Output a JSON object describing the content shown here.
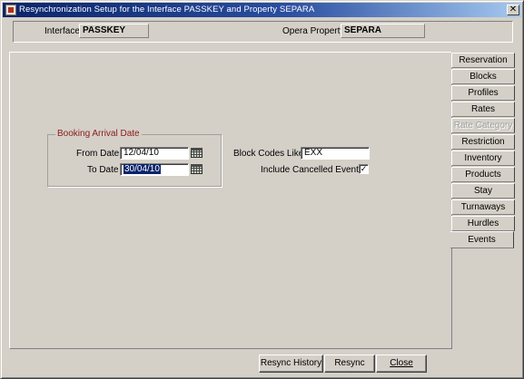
{
  "window": {
    "title": "Resynchronization Setup for the Interface PASSKEY and Property SEPARA",
    "close_glyph": "✕"
  },
  "header": {
    "interface_label": "Interface",
    "interface_value": "PASSKEY",
    "property_label": "Opera Property",
    "property_value": "SEPARA"
  },
  "booking_group": {
    "title": "Booking Arrival Date",
    "from_label": "From  Date",
    "from_value": "12/04/10",
    "to_label": "To Date",
    "to_value": "30/04/10"
  },
  "block_codes": {
    "label": "Block Codes Like",
    "value": "EXX"
  },
  "include_cancelled": {
    "label": "Include Cancelled Events",
    "checked": true,
    "glyph": "✓"
  },
  "tabs": [
    {
      "label": "Reservation",
      "state": "normal"
    },
    {
      "label": "Blocks",
      "state": "normal"
    },
    {
      "label": "Profiles",
      "state": "normal"
    },
    {
      "label": "Rates",
      "state": "normal"
    },
    {
      "label": "Rate Category",
      "state": "disabled"
    },
    {
      "label": "Restriction",
      "state": "normal"
    },
    {
      "label": "Inventory",
      "state": "normal"
    },
    {
      "label": "Products",
      "state": "normal"
    },
    {
      "label": "Stay",
      "state": "normal"
    },
    {
      "label": "Turnaways",
      "state": "normal"
    },
    {
      "label": "Hurdles",
      "state": "normal"
    },
    {
      "label": "Events",
      "state": "active"
    }
  ],
  "buttons": {
    "resync_history": "Resync History",
    "resync": "Resync",
    "close": "Close"
  }
}
